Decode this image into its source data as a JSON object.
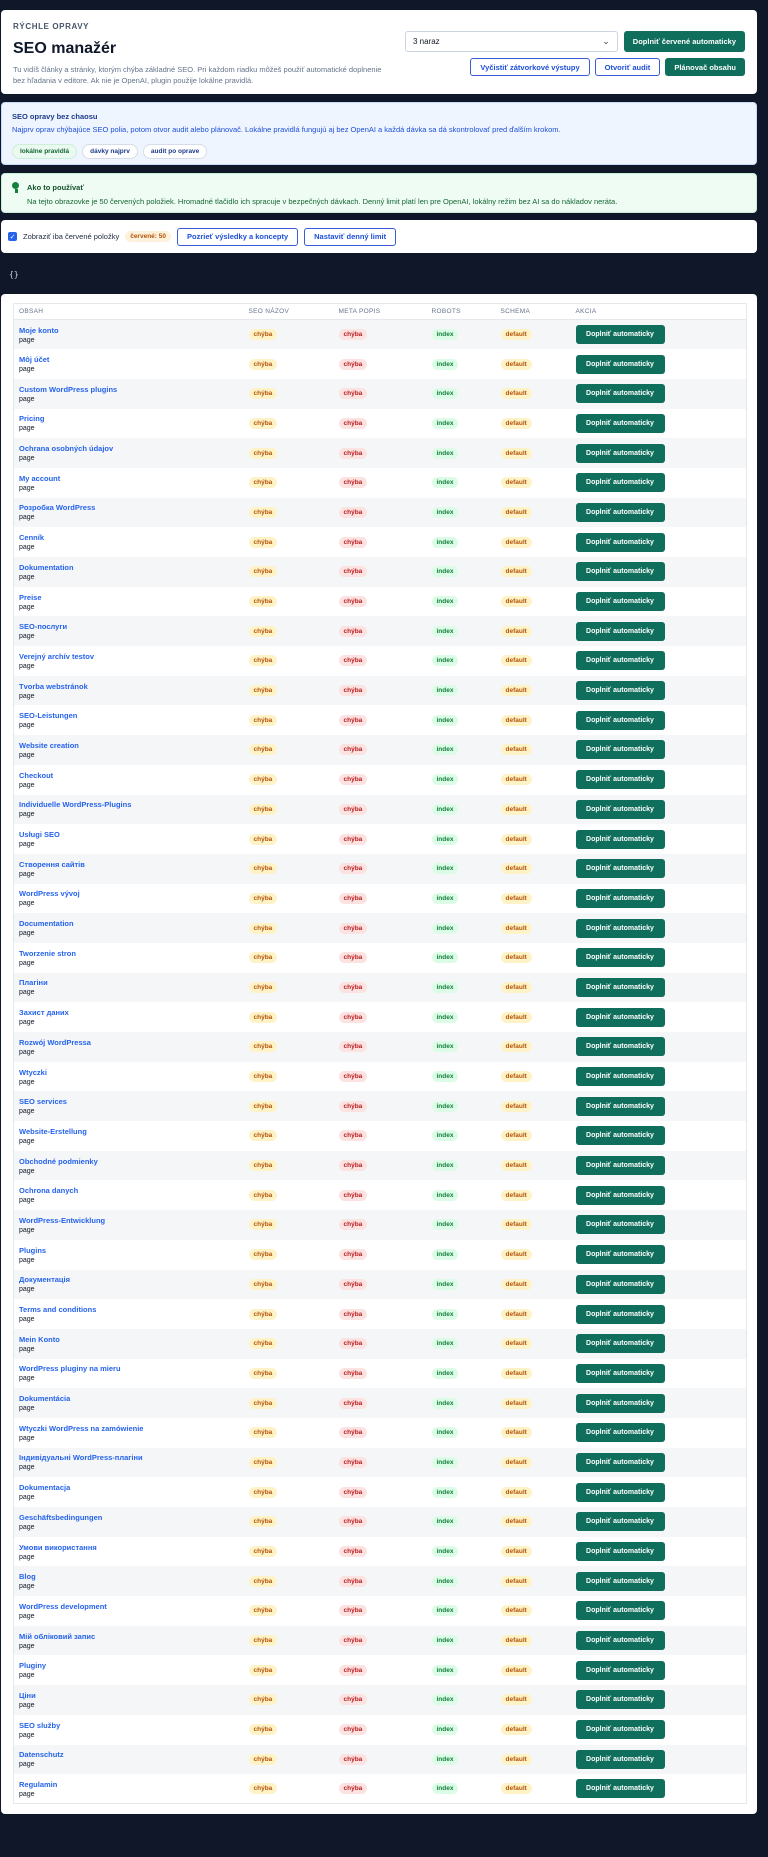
{
  "header": {
    "eyebrow": "RÝCHLE OPRAVY",
    "title": "SEO manažér",
    "description": "Tu vidíš články a stránky, ktorým chýba základné SEO. Pri každom riadku môžeš použiť automatické doplnenie bez hľadania v editore. Ak nie je OpenAI, plugin použije lokálne pravidlá.",
    "batch_select": "3 naraz",
    "fill_red_button": "Doplniť červené automaticky",
    "clear_button": "Vyčistiť zátvorkové výstupy",
    "audit_button": "Otvoriť audit",
    "planner_button": "Plánovač obsahu"
  },
  "info": {
    "heading": "SEO opravy bez chaosu",
    "text": "Najprv oprav chýbajúce SEO polia, potom otvor audit alebo plánovač. Lokálne pravidlá fungujú aj bez OpenAI a každá dávka sa dá skontrolovať pred ďalším krokom.",
    "chips": [
      "lokálne pravidlá",
      "dávky najprv",
      "audit po oprave"
    ]
  },
  "howto": {
    "heading": "Ako to používať",
    "text": "Na tejto obrazovke je 50 červených položiek. Hromadné tlačidlo ich spracuje v bezpečných dávkach. Denný limit platí len pre OpenAI, lokálny režim bez AI sa do nákladov neráta."
  },
  "filter": {
    "checkbox_label": "Zobraziť iba červené položky",
    "count_badge": "červené: 50",
    "results_button": "Pozrieť výsledky a koncepty",
    "limit_button": "Nastaviť denný limit"
  },
  "code_text": "{}",
  "table": {
    "columns": [
      "OBSAH",
      "SEO NÁZOV",
      "META POPIS",
      "ROBOTS",
      "SCHEMA",
      "AKCIA"
    ],
    "seo_status": "chýba",
    "meta_status": "chýba",
    "robots_value": "index",
    "schema_value": "default",
    "action_label": "Doplniť automaticky",
    "rows": [
      {
        "title": "Moje konto",
        "type": "page"
      },
      {
        "title": "Môj účet",
        "type": "page"
      },
      {
        "title": "Custom WordPress plugins",
        "type": "page"
      },
      {
        "title": "Pricing",
        "type": "page"
      },
      {
        "title": "Ochrana osobných údajov",
        "type": "page"
      },
      {
        "title": "My account",
        "type": "page"
      },
      {
        "title": "Розробка WordPress",
        "type": "page"
      },
      {
        "title": "Cenník",
        "type": "page"
      },
      {
        "title": "Dokumentation",
        "type": "page"
      },
      {
        "title": "Preise",
        "type": "page"
      },
      {
        "title": "SEO-послуги",
        "type": "page"
      },
      {
        "title": "Verejný archív testov",
        "type": "page"
      },
      {
        "title": "Tvorba webstránok",
        "type": "page"
      },
      {
        "title": "SEO-Leistungen",
        "type": "page"
      },
      {
        "title": "Website creation",
        "type": "page"
      },
      {
        "title": "Checkout",
        "type": "page"
      },
      {
        "title": "Individuelle WordPress-Plugins",
        "type": "page"
      },
      {
        "title": "Usługi SEO",
        "type": "page"
      },
      {
        "title": "Створення сайтів",
        "type": "page"
      },
      {
        "title": "WordPress vývoj",
        "type": "page"
      },
      {
        "title": "Documentation",
        "type": "page"
      },
      {
        "title": "Tworzenie stron",
        "type": "page"
      },
      {
        "title": "Плагіни",
        "type": "page"
      },
      {
        "title": "Захист даних",
        "type": "page"
      },
      {
        "title": "Rozwój WordPressa",
        "type": "page"
      },
      {
        "title": "Wtyczki",
        "type": "page"
      },
      {
        "title": "SEO services",
        "type": "page"
      },
      {
        "title": "Website-Erstellung",
        "type": "page"
      },
      {
        "title": "Obchodné podmienky",
        "type": "page"
      },
      {
        "title": "Ochrona danych",
        "type": "page"
      },
      {
        "title": "WordPress-Entwicklung",
        "type": "page"
      },
      {
        "title": "Plugins",
        "type": "page"
      },
      {
        "title": "Документація",
        "type": "page"
      },
      {
        "title": "Terms and conditions",
        "type": "page"
      },
      {
        "title": "Mein Konto",
        "type": "page"
      },
      {
        "title": "WordPress pluginy na mieru",
        "type": "page"
      },
      {
        "title": "Dokumentácia",
        "type": "page"
      },
      {
        "title": "Wtyczki WordPress na zamówienie",
        "type": "page"
      },
      {
        "title": "Індивідуальні WordPress-плагіни",
        "type": "page"
      },
      {
        "title": "Dokumentacja",
        "type": "page"
      },
      {
        "title": "Geschäftsbedingungen",
        "type": "page"
      },
      {
        "title": "Умови використання",
        "type": "page"
      },
      {
        "title": "Blog",
        "type": "page"
      },
      {
        "title": "WordPress development",
        "type": "page"
      },
      {
        "title": "Мій обліковий запис",
        "type": "page"
      },
      {
        "title": "Pluginy",
        "type": "page"
      },
      {
        "title": "Ціни",
        "type": "page"
      },
      {
        "title": "SEO služby",
        "type": "page"
      },
      {
        "title": "Datenschutz",
        "type": "page"
      },
      {
        "title": "Regulamin",
        "type": "page"
      }
    ]
  }
}
